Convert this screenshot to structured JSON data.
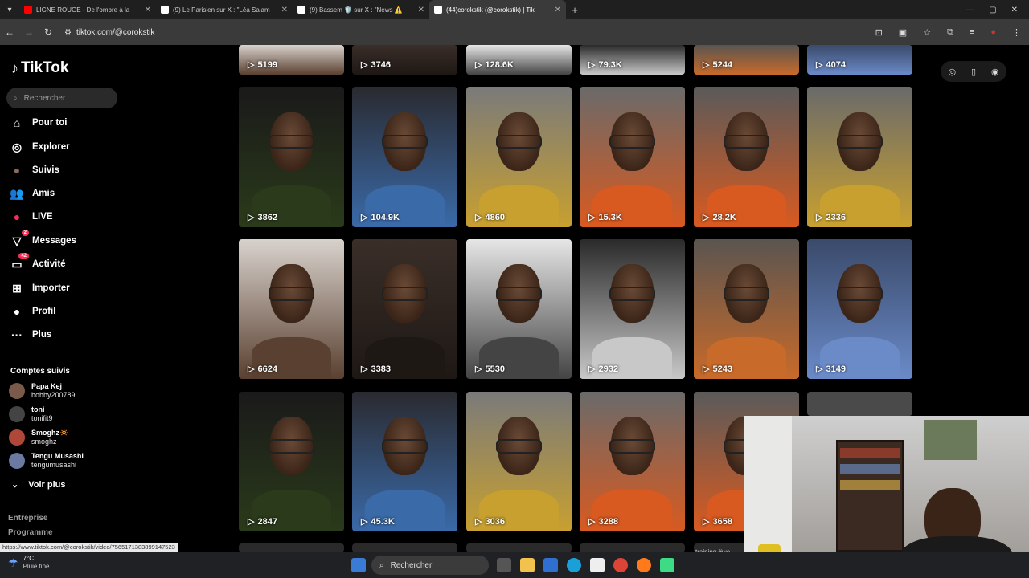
{
  "browser": {
    "tabs": [
      {
        "title": "LIGNE ROUGE - De l'ombre à la",
        "fav_color": "#ff0000",
        "active": false
      },
      {
        "title": "(9) Le Parisien sur X : \"Léa Salam",
        "fav_color": "#000000",
        "active": false
      },
      {
        "title": "(9) Bassem 🛡️ sur X : \"News ⚠️",
        "fav_color": "#000000",
        "active": false
      },
      {
        "title": "(44)corokstik (@corokstik) | Tik",
        "fav_color": "#000000",
        "active": true
      }
    ],
    "url": "tiktok.com/@corokstik",
    "status_link": "https://www.tiktok.com/@corokstik/video/7565171383899147523"
  },
  "sidebar": {
    "logo": "TikTok",
    "search_placeholder": "Rechercher",
    "nav": [
      {
        "label": "Pour toi",
        "icon": "home-icon",
        "glyph": "⌂"
      },
      {
        "label": "Explorer",
        "icon": "compass-icon",
        "glyph": "◎"
      },
      {
        "label": "Suivis",
        "icon": "following-avatar-icon",
        "glyph": "●"
      },
      {
        "label": "Amis",
        "icon": "friends-icon",
        "glyph": "👥"
      },
      {
        "label": "LIVE",
        "icon": "live-icon",
        "glyph": "●"
      },
      {
        "label": "Messages",
        "icon": "messages-icon",
        "glyph": "▽",
        "badge": "2"
      },
      {
        "label": "Activité",
        "icon": "activity-icon",
        "glyph": "▭",
        "badge": "42"
      },
      {
        "label": "Importer",
        "icon": "upload-icon",
        "glyph": "⊞"
      },
      {
        "label": "Profil",
        "icon": "profile-icon",
        "glyph": "●"
      },
      {
        "label": "Plus",
        "icon": "more-icon",
        "glyph": "···"
      }
    ],
    "following_title": "Comptes suivis",
    "following": [
      {
        "name": "Papa Kej",
        "handle": "bobby200789",
        "color": "#7a5a4a"
      },
      {
        "name": "toni",
        "handle": "tonifit9",
        "color": "#444444"
      },
      {
        "name": "Smoghz🔅",
        "handle": "smoghz",
        "color": "#b0483a"
      },
      {
        "name": "Tengu Musashi",
        "handle": "tengumusashi",
        "color": "#6a7aa0"
      }
    ],
    "see_more": "Voir plus",
    "footer": [
      "Entreprise",
      "Programme"
    ]
  },
  "videos": {
    "row0": [
      "5199",
      "3746",
      "128.6K",
      "79.3K",
      "5244",
      "4074"
    ],
    "row1": [
      "3862",
      "104.9K",
      "4860",
      "15.3K",
      "28.2K",
      "2336"
    ],
    "row2": [
      "6624",
      "3383",
      "5530",
      "2932",
      "5243",
      "3149"
    ],
    "row3": [
      "2847",
      "45.3K",
      "3036",
      "3288",
      "3658"
    ],
    "row4_caption": "training #we"
  },
  "taskbar": {
    "temp": "7°C",
    "weather": "Pluie fine",
    "search": "Rechercher"
  }
}
